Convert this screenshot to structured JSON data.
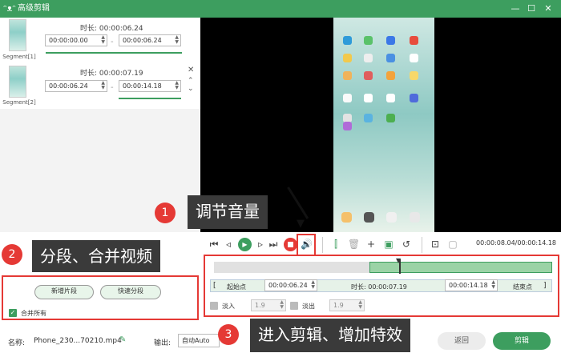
{
  "window": {
    "title": "高级剪辑",
    "icon": "cat-logo-icon",
    "controls": [
      "minimize",
      "maximize",
      "close"
    ]
  },
  "segments": [
    {
      "label": "Segment[1]",
      "duration_label": "时长: 00:00:06.24",
      "start": "00:00:00.00",
      "end": "00:00:06.24"
    },
    {
      "label": "Segment[2]",
      "duration_label": "时长: 00:00:07.19",
      "start": "00:00:06.24",
      "end": "00:00:14.18"
    }
  ],
  "player": {
    "time_display": "00:00:08.04/00:00:14.18"
  },
  "range": {
    "start_btn": "起始点",
    "start_value": "00:00:06.24",
    "duration_label": "时长: 00:00:07.19",
    "end_value": "00:00:14.18",
    "end_btn": "结束点"
  },
  "fade": {
    "in_label": "淡入",
    "in_value": "1.9",
    "out_label": "淡出",
    "out_value": "1.9"
  },
  "segment_actions": {
    "add": "新增片段",
    "quick": "快速分段",
    "merge_all": "合并所有"
  },
  "bottom": {
    "name_label": "名称:",
    "file_name": "Phone_230...70210.mp4",
    "output_label": "输出:",
    "output_value": "自动Auto",
    "back": "返回",
    "edit": "剪辑"
  },
  "callouts": [
    {
      "num": "1",
      "text": "调节音量"
    },
    {
      "num": "2",
      "text": "分段、合并视频"
    },
    {
      "num": "3",
      "text": "进入剪辑、增加特效"
    }
  ],
  "colors": {
    "accent": "#3d9e5f",
    "highlight": "#e53935"
  }
}
